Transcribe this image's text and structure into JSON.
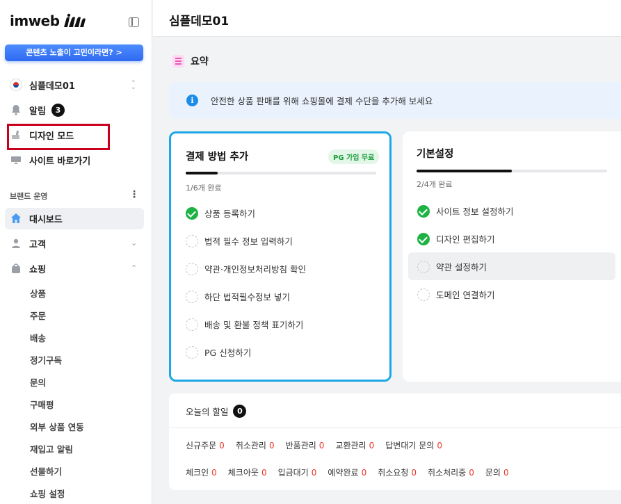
{
  "brand": {
    "logo_text": "imweb"
  },
  "promo_banner": "콘텐츠 노출이 고민이라면? >",
  "sidebar": {
    "site_selector": "심플데모01",
    "alerts_label": "알림",
    "alerts_count": "3",
    "design_mode": "디자인 모드",
    "visit_site": "사이트 바로가기",
    "section_label": "브랜드 운영",
    "dashboard": "대시보드",
    "customers": "고객",
    "shopping": "쇼핑",
    "shopping_items": [
      "상품",
      "주문",
      "배송",
      "정기구독",
      "문의",
      "구매평",
      "외부 상품 연동",
      "재입고 알림",
      "선물하기",
      "쇼핑 설정"
    ]
  },
  "header": {
    "title": "심플데모01"
  },
  "summary": {
    "title": "요약"
  },
  "notice": {
    "text": "안전한 상품 판매를 위해 쇼핑몰에 결제 수단을 추가해 보세요"
  },
  "payment_card": {
    "title": "결제 방법 추가",
    "badge": "PG 가입 무료",
    "progress_text": "1/6개 완료",
    "progress": 0.167,
    "tasks": [
      {
        "label": "상품 등록하기",
        "done": true
      },
      {
        "label": "법적 필수 정보 입력하기",
        "done": false
      },
      {
        "label": "약관·개인정보처리방침 확인",
        "done": false
      },
      {
        "label": "하단 법적필수정보 넣기",
        "done": false
      },
      {
        "label": "배송 및 환불 정책 표기하기",
        "done": false
      },
      {
        "label": "PG 신청하기",
        "done": false
      }
    ]
  },
  "basic_card": {
    "title": "기본설정",
    "progress_text": "2/4개 완료",
    "progress": 0.5,
    "tasks": [
      {
        "label": "사이트 정보 설정하기",
        "done": true
      },
      {
        "label": "디자인 편집하기",
        "done": true
      },
      {
        "label": "약관 설정하기",
        "done": false
      },
      {
        "label": "도메인 연결하기",
        "done": false
      }
    ]
  },
  "todo": {
    "title": "오늘의 할일",
    "count": "0",
    "row1": [
      {
        "label": "신규주문",
        "count": "0"
      },
      {
        "label": "취소관리",
        "count": "0"
      },
      {
        "label": "반품관리",
        "count": "0"
      },
      {
        "label": "교환관리",
        "count": "0"
      },
      {
        "label": "답변대기 문의",
        "count": "0"
      }
    ],
    "row2": [
      {
        "label": "체크인",
        "count": "0"
      },
      {
        "label": "체크아웃",
        "count": "0"
      },
      {
        "label": "입금대기",
        "count": "0"
      },
      {
        "label": "예약완료",
        "count": "0"
      },
      {
        "label": "취소요청",
        "count": "0"
      },
      {
        "label": "취소처리중",
        "count": "0"
      },
      {
        "label": "문의",
        "count": "0"
      }
    ]
  },
  "colors": {
    "accent_blue": "#1aa8e8",
    "done_green": "#1db344",
    "count_red": "#e8382f",
    "highlight_red": "#c8001e"
  }
}
